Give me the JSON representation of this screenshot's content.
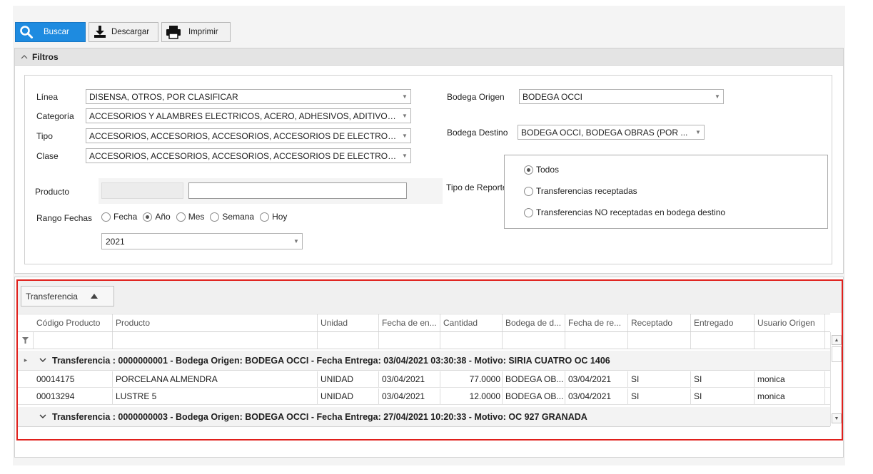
{
  "toolbar": {
    "search_label": "Buscar",
    "download_label": "Descargar",
    "print_label": "Imprimir"
  },
  "filters": {
    "section_title": "Filtros",
    "linea": {
      "label": "Línea",
      "value": "DISENSA, OTROS, POR CLASIFICAR"
    },
    "categoria": {
      "label": "Categoría",
      "value": "ACCESORIOS Y ALAMBRES ELECTRICOS, ACERO, ADHESIVOS, ADITIVOS..."
    },
    "tipo": {
      "label": "Tipo",
      "value": "ACCESORIOS, ACCESORIOS, ACCESORIOS, ACCESORIOS DE ELECTROB..."
    },
    "clase": {
      "label": "Clase",
      "value": "ACCESORIOS, ACCESORIOS, ACCESORIOS, ACCESORIOS DE ELECTROB..."
    },
    "producto": {
      "label": "Producto",
      "code_value": "",
      "name_value": ""
    },
    "rango_fechas": {
      "label": "Rango Fechas",
      "options": [
        "Fecha",
        "Año",
        "Mes",
        "Semana",
        "Hoy"
      ],
      "selected": "Año",
      "value": "2021"
    },
    "bodega_origen": {
      "label": "Bodega Origen",
      "value": "BODEGA OCCI"
    },
    "bodega_destino": {
      "label": "Bodega Destino",
      "value": "BODEGA OCCI, BODEGA OBRAS (POR ..."
    },
    "tipo_reporte": {
      "label": "Tipo de Reporte",
      "options": [
        "Todos",
        "Transferencias receptadas",
        "Transferencias NO receptadas en bodega destino"
      ],
      "selected": "Todos"
    }
  },
  "grid": {
    "group_by_chip": "Transferencia",
    "columns": [
      "Código Producto",
      "Producto",
      "Unidad",
      "Fecha de en...",
      "Cantidad",
      "Bodega de d...",
      "Fecha de re...",
      "Receptado",
      "Entregado",
      "Usuario Origen"
    ],
    "groups": [
      {
        "header": "Transferencia : 0000000001  -  Bodega Origen: BODEGA OCCI  -  Fecha Entrega: 03/04/2021 03:30:38  -  Motivo: SIRIA CUATRO OC 1406",
        "rows": [
          [
            "00014175",
            "PORCELANA ALMENDRA",
            "UNIDAD",
            "03/04/2021",
            "77.0000",
            "BODEGA OB...",
            "03/04/2021",
            "SI",
            "SI",
            "monica"
          ],
          [
            "00013294",
            "LUSTRE 5",
            "UNIDAD",
            "03/04/2021",
            "12.0000",
            "BODEGA OB...",
            "03/04/2021",
            "SI",
            "SI",
            "monica"
          ]
        ]
      },
      {
        "header": "Transferencia : 0000000003  -  Bodega Origen: BODEGA OCCI  -  Fecha Entrega: 27/04/2021 10:20:33  -  Motivo: OC 927 GRANADA",
        "rows": []
      }
    ]
  },
  "colors": {
    "primary_button": "#1e8be0",
    "highlight_frame": "#e0201c"
  }
}
